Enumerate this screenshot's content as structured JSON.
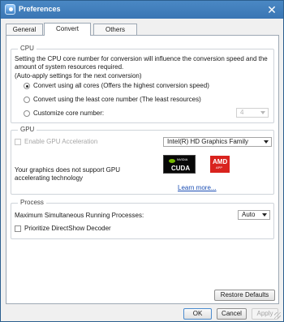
{
  "window": {
    "title": "Preferences",
    "close_glyph": "✕"
  },
  "tabs": [
    {
      "label": "General",
      "active": false
    },
    {
      "label": "Convert",
      "active": true
    },
    {
      "label": "Others",
      "active": false
    }
  ],
  "cpu": {
    "title": "CPU",
    "description": "Setting the CPU core number for conversion will influence the conversion speed and the amount of system resources required.",
    "note": "(Auto-apply settings for the next conversion)",
    "options": [
      {
        "label": "Convert using all cores (Offers the highest conversion speed)",
        "checked": true
      },
      {
        "label": "Convert using the least core number (The least resources)",
        "checked": false
      },
      {
        "label": "Customize core number:",
        "checked": false
      }
    ],
    "core_number": "4"
  },
  "gpu": {
    "title": "GPU",
    "enable_label": "Enable GPU Acceleration",
    "device": "Intel(R) HD Graphics Family",
    "message": "Your graphics does not support GPU accelerating technology",
    "learn_more": "Learn more...",
    "logos": {
      "nvidia_brand": "NVIDIA",
      "nvidia_product": "CUDA",
      "amd_brand": "AMD",
      "amd_product": "APP"
    }
  },
  "process": {
    "title": "Process",
    "max_label": "Maximum Simultaneous Running Processes:",
    "max_value": "Auto",
    "prioritize_label": "Prioritize DirectShow Decoder"
  },
  "buttons": {
    "restore": "Restore Defaults",
    "ok": "OK",
    "cancel": "Cancel",
    "apply": "Apply"
  },
  "colors": {
    "titlebar": "#3a76b4",
    "link": "#1a4db3",
    "nvidia_green": "#76b900",
    "amd_red": "#d9231e"
  }
}
